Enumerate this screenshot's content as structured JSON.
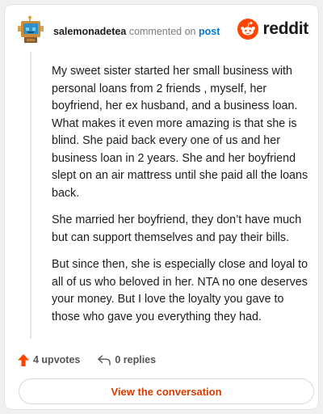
{
  "comment": {
    "username": "salemonadetea",
    "action_text": "commented on",
    "link_text": "post",
    "paragraphs": [
      "My sweet sister started her small business with personal loans from 2 friends , myself, her boyfriend, her ex husband, and a business loan. What makes it even more amazing is that she is blind. She paid back every one of us and her business loan in 2 years. She and her boyfriend slept on an air mattress until she paid all the loans back.",
      "She married her boyfriend, they don’t have much but can support themselves and pay their bills.",
      "But since then, she is especially close and loyal to all of us who beloved in her. NTA no one deserves your money. But I love the loyalty you gave to those who gave you everything they had."
    ]
  },
  "brand": {
    "name": "reddit",
    "icon": "reddit-logo-icon",
    "color": "#ff4500"
  },
  "actions": {
    "upvotes_label": "4 upvotes",
    "replies_label": "0 replies",
    "upvote_icon": "upvote-arrow-icon",
    "reply_icon": "reply-arrow-icon"
  },
  "cta": {
    "label": "View the conversation"
  },
  "colors": {
    "accent": "#d93a00",
    "link": "#0079d3",
    "upvote": "#ff4500"
  }
}
